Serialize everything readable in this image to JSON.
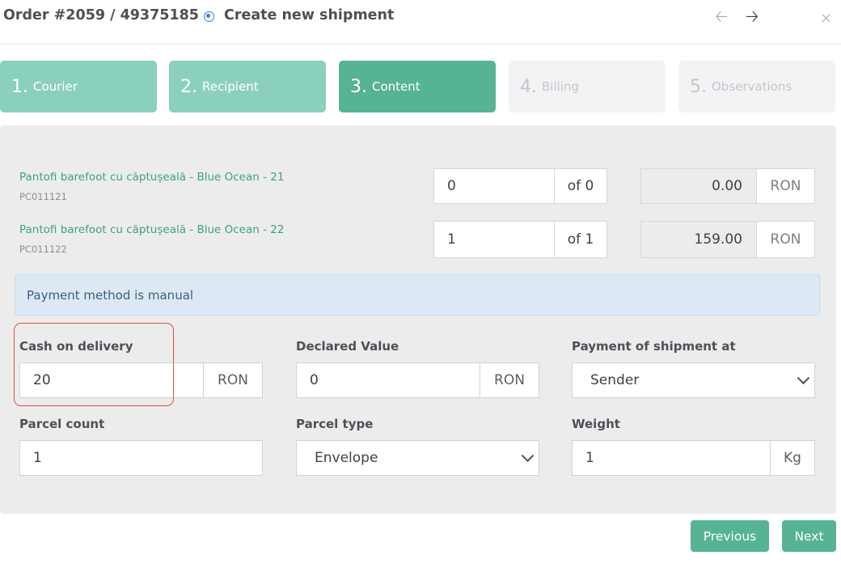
{
  "header": {
    "order_label": "Order #2059 / 49375185",
    "subtitle": "Create new shipment",
    "prev_icon": "arrow-left-icon",
    "next_icon": "arrow-right-icon",
    "close_icon": "close-icon",
    "close_glyph": "×"
  },
  "steps": [
    {
      "num": "1.",
      "label": "Courier",
      "state": "done"
    },
    {
      "num": "2.",
      "label": "Recipient",
      "state": "done"
    },
    {
      "num": "3.",
      "label": "Content",
      "state": "active"
    },
    {
      "num": "4.",
      "label": "Billing",
      "state": "disabled"
    },
    {
      "num": "5.",
      "label": "Observations",
      "state": "disabled"
    }
  ],
  "products": [
    {
      "name": "Pantofi barefoot cu căptușeală - Blue Ocean - 21",
      "sku": "PC011121",
      "qty": "0",
      "of": "of 0",
      "price": "0.00",
      "currency": "RON"
    },
    {
      "name": "Pantofi barefoot cu căptușeală - Blue Ocean - 22",
      "sku": "PC011122",
      "qty": "1",
      "of": "of 1",
      "price": "159.00",
      "currency": "RON"
    }
  ],
  "alert": {
    "text": "Payment method is manual"
  },
  "form": {
    "cod": {
      "label": "Cash on delivery",
      "value": "20",
      "unit": "RON"
    },
    "declared": {
      "label": "Declared Value",
      "value": "0",
      "unit": "RON"
    },
    "payment_at": {
      "label": "Payment of shipment at",
      "value": "Sender"
    },
    "parcel_count": {
      "label": "Parcel count",
      "value": "1"
    },
    "parcel_type": {
      "label": "Parcel type",
      "value": "Envelope"
    },
    "weight": {
      "label": "Weight",
      "value": "1",
      "unit": "Kg"
    }
  },
  "buttons": {
    "previous": "Previous",
    "next": "Next"
  },
  "colors": {
    "accent": "#56b394",
    "step_done": "#8bd0bd",
    "link": "#3ea377",
    "highlight": "#d45442"
  }
}
